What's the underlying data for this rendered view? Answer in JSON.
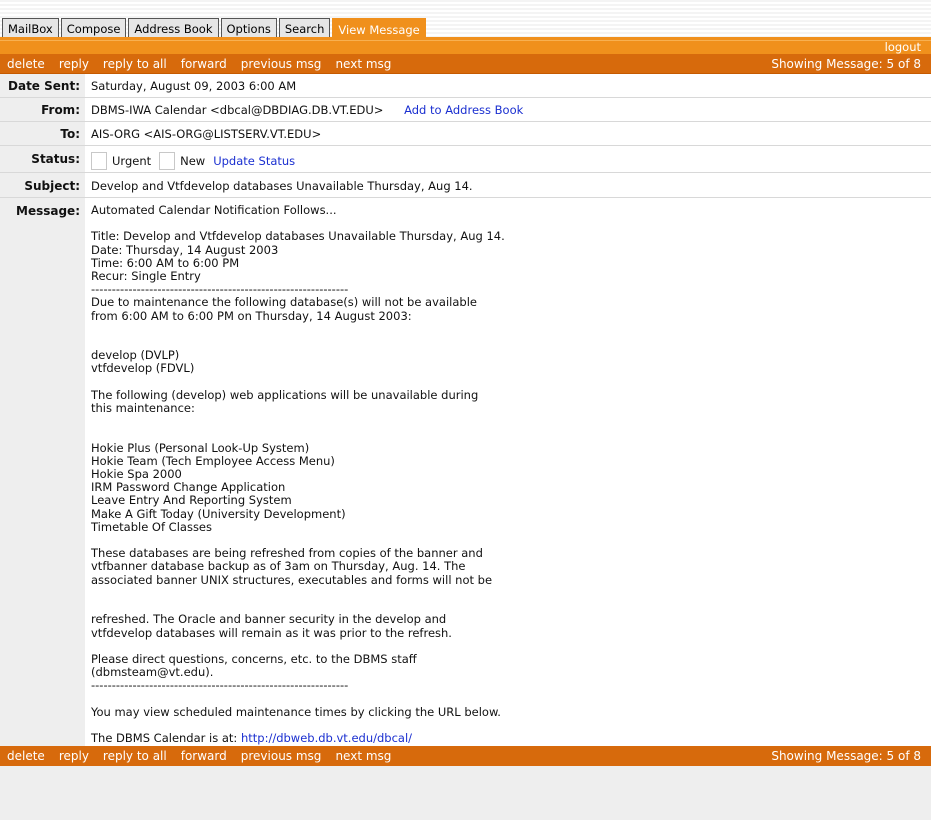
{
  "tabs": [
    {
      "label": "MailBox"
    },
    {
      "label": "Compose"
    },
    {
      "label": "Address Book"
    },
    {
      "label": "Options"
    },
    {
      "label": "Search"
    },
    {
      "label": "View Message"
    }
  ],
  "logout": "logout",
  "toolbar": {
    "delete": "delete",
    "reply": "reply",
    "reply_all": "reply to all",
    "forward": "forward",
    "previous": "previous msg",
    "next": "next msg",
    "showing": "Showing Message: 5 of 8"
  },
  "headers": {
    "date_label": "Date Sent:",
    "date_value": "Saturday, August 09, 2003 6:00 AM",
    "from_label": "From:",
    "from_value": "DBMS-IWA Calendar <dbcal@DBDIAG.DB.VT.EDU>",
    "add_to_address_book": "Add to Address Book",
    "to_label": "To:",
    "to_value": "AIS-ORG <AIS-ORG@LISTSERV.VT.EDU>",
    "status_label": "Status:",
    "urgent": "Urgent",
    "new": "New",
    "update_status": "Update Status",
    "subject_label": "Subject:",
    "subject_value": "Develop and Vtfdevelop databases Unavailable Thursday, Aug 14.",
    "message_label": "Message:"
  },
  "message": {
    "body": "Automated Calendar Notification Follows...\n\nTitle: Develop and Vtfdevelop databases Unavailable Thursday, Aug 14.\nDate: Thursday, 14 August 2003\nTime: 6:00 AM to 6:00 PM\nRecur: Single Entry\n--------------------------------------------------------------\nDue to maintenance the following database(s) will not be available\nfrom 6:00 AM to 6:00 PM on Thursday, 14 August 2003:\n\n\ndevelop (DVLP)\nvtfdevelop (FDVL)\n\nThe following (develop) web applications will be unavailable during\nthis maintenance:\n\n\nHokie Plus (Personal Look-Up System)\nHokie Team (Tech Employee Access Menu)\nHokie Spa 2000\nIRM Password Change Application\nLeave Entry And Reporting System\nMake A Gift Today (University Development)\nTimetable Of Classes\n\nThese databases are being refreshed from copies of the banner and\nvtfbanner database backup as of 3am on Thursday, Aug. 14. The\nassociated banner UNIX structures, executables and forms will not be\n\n\nrefreshed. The Oracle and banner security in the develop and\nvtfdevelop databases will remain as it was prior to the refresh.\n\nPlease direct questions, concerns, etc. to the DBMS staff\n(dbmsteam@vt.edu).\n--------------------------------------------------------------\n\nYou may view scheduled maintenance times by clicking the URL below.\n\n",
    "calendar_prefix": "The DBMS Calendar is at: ",
    "calendar_url": "http://dbweb.db.vt.edu/dbcal/"
  },
  "colors": {
    "tab_active": "#f0901c",
    "toolbar": "#d76a0c",
    "link": "#1a2fd0"
  }
}
